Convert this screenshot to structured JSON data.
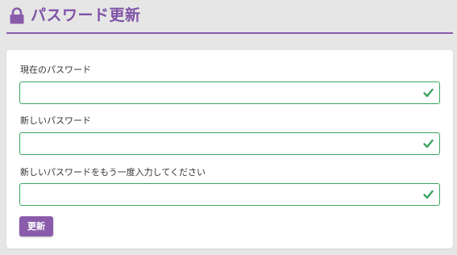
{
  "header": {
    "title": "パスワード更新",
    "icon": "lock-icon"
  },
  "form": {
    "fields": [
      {
        "label": "現在のパスワード",
        "value": "",
        "status": "valid"
      },
      {
        "label": "新しいパスワード",
        "value": "",
        "status": "valid"
      },
      {
        "label": "新しいパスワードをもう一度入力してください",
        "value": "",
        "status": "valid"
      }
    ],
    "submit_label": "更新"
  },
  "colors": {
    "accent": "#8a5bab",
    "valid": "#3aa55e",
    "background": "#e6e6e6"
  }
}
